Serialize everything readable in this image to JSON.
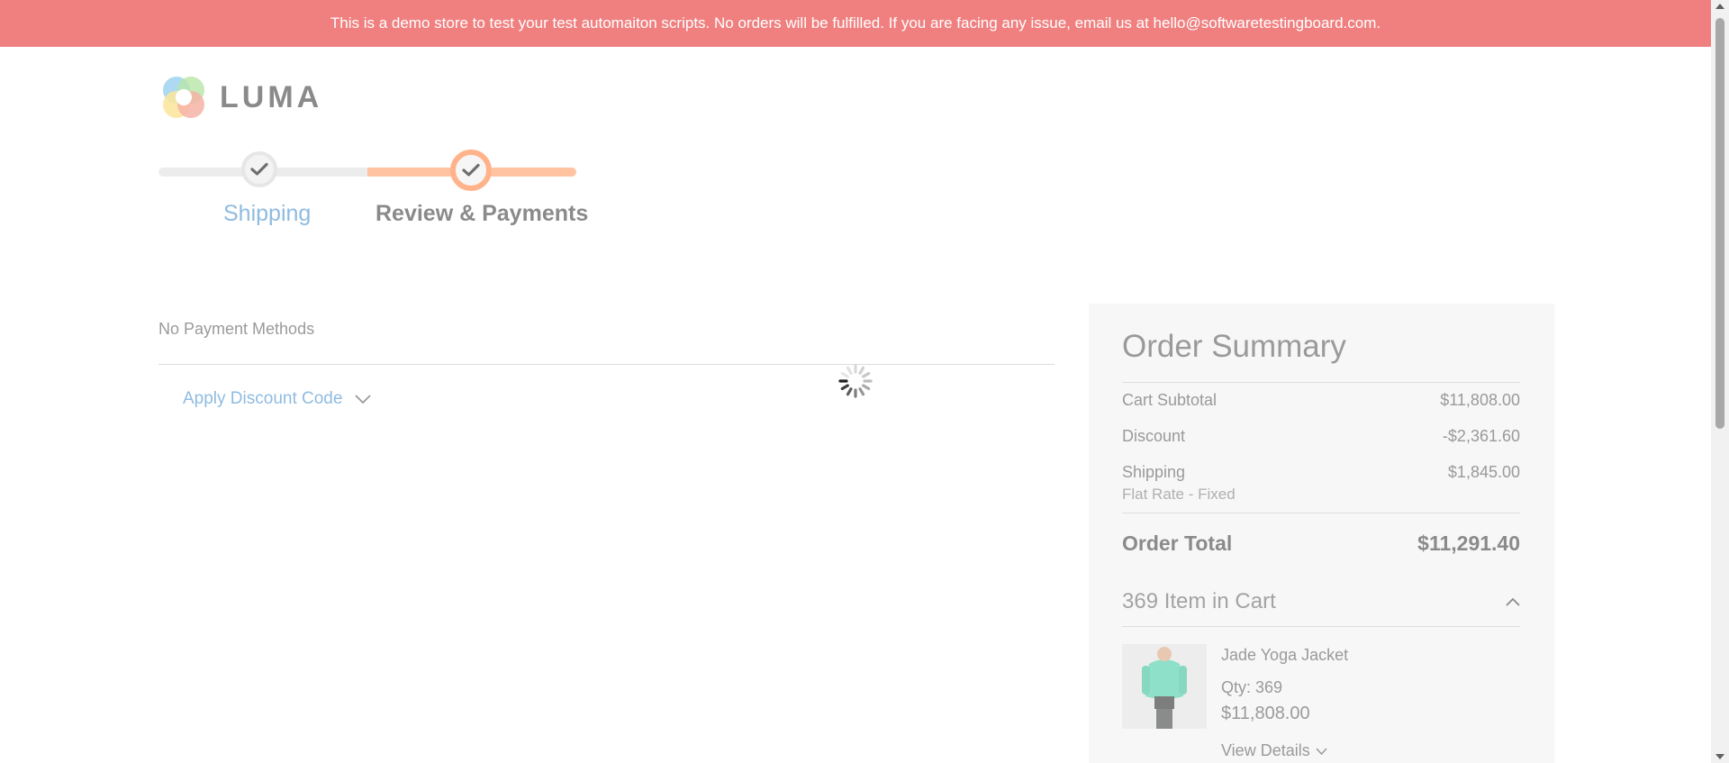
{
  "notice": {
    "text": "This is a demo store to test your test automaiton scripts. No orders will be fulfilled. If you are facing any issue, email us at hello@softwaretestingboard.com."
  },
  "logo": {
    "text": "LUMA"
  },
  "steps": [
    {
      "label": "Shipping",
      "state": "complete"
    },
    {
      "label": "Review & Payments",
      "state": "active"
    }
  ],
  "payment": {
    "empty_text": "No Payment Methods",
    "discount_label": "Apply Discount Code"
  },
  "summary": {
    "title": "Order Summary",
    "subtotal_label": "Cart Subtotal",
    "subtotal_value": "$11,808.00",
    "discount_label": "Discount",
    "discount_value": "-$2,361.60",
    "shipping_label": "Shipping",
    "shipping_value": "$1,845.00",
    "shipping_method": "Flat Rate - Fixed",
    "total_label": "Order Total",
    "total_value": "$11,291.40",
    "items_title": "369 Item in Cart",
    "product": {
      "name": "Jade Yoga Jacket",
      "qty": "Qty: 369",
      "price": "$11,808.00",
      "view_details": "View Details"
    }
  },
  "colors": {
    "notice_bg": "#f08080",
    "accent_orange": "#ffb38a",
    "link_blue": "#8fbbe0",
    "summary_bg": "#f7f7f7"
  }
}
